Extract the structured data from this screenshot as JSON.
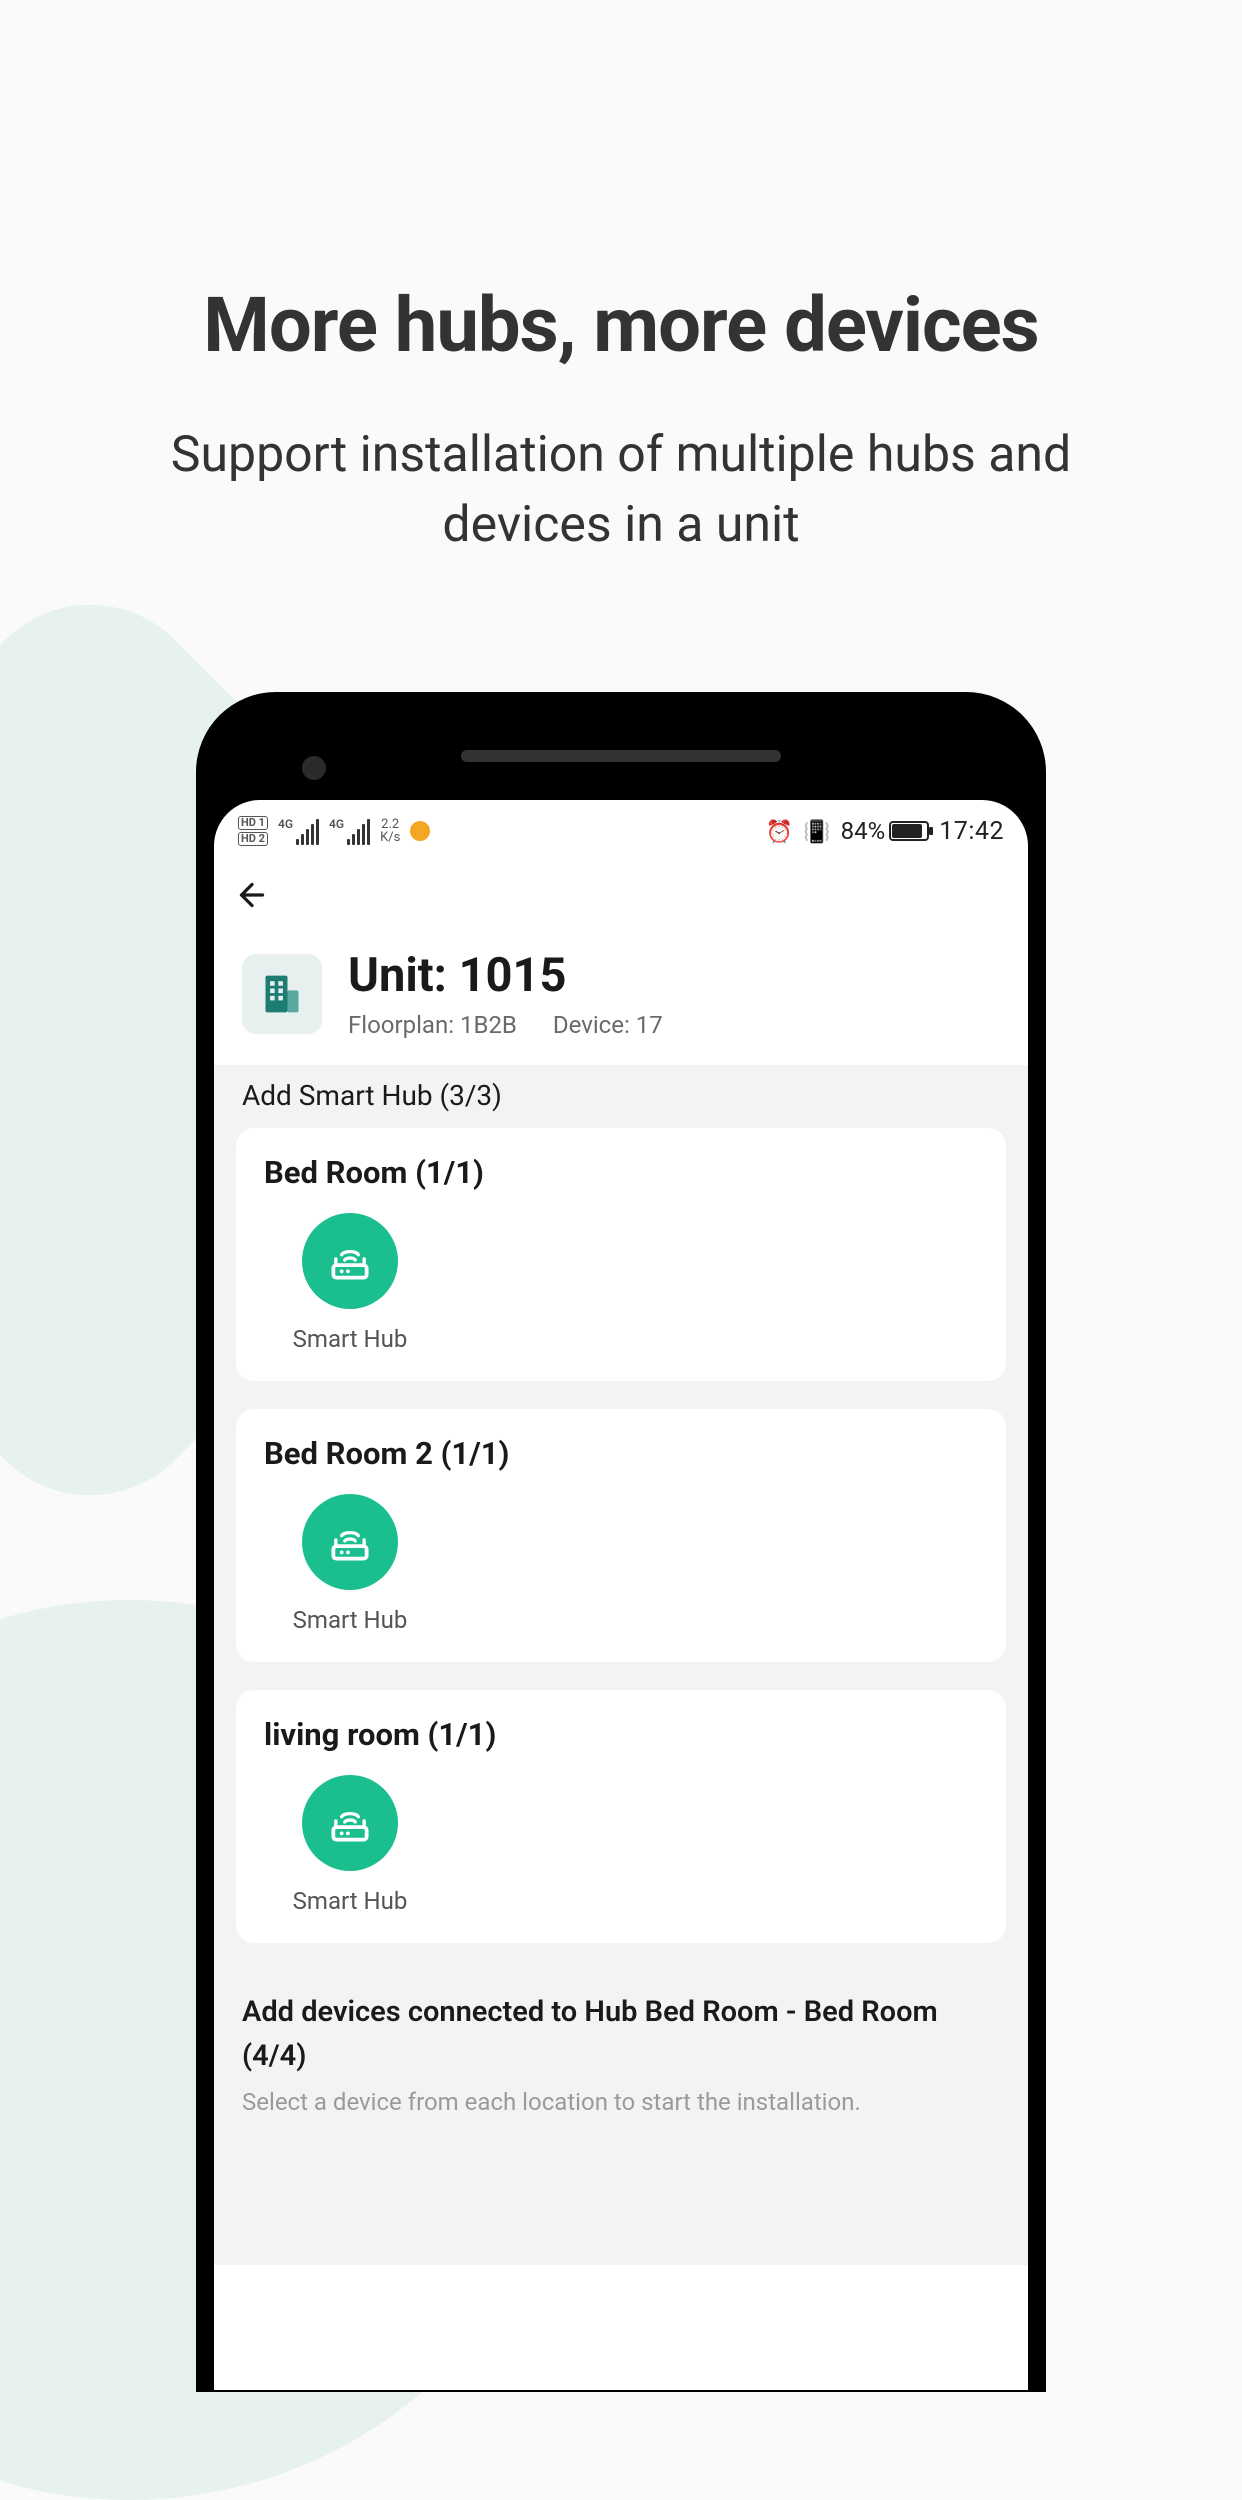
{
  "marketing": {
    "title": "More hubs, more devices",
    "subtitle": "Support installation of multiple hubs and devices in a unit"
  },
  "status": {
    "hd1": "HD 1",
    "hd2": "HD 2",
    "net1_label": "4G",
    "net2_label": "4G",
    "speed_top": "2.2",
    "speed_bottom": "K/s",
    "battery_pct": "84%",
    "time": "17:42"
  },
  "unit": {
    "title": "Unit: 1015",
    "floorplan_label": "Floorplan: 1B2B",
    "device_label": "Device: 17"
  },
  "hub_section": {
    "label": "Add Smart Hub (3/3)"
  },
  "rooms": [
    {
      "name": "Bed Room (1/1)",
      "hub_label": "Smart Hub"
    },
    {
      "name": "Bed Room 2  (1/1)",
      "hub_label": "Smart Hub"
    },
    {
      "name": "living room (1/1)",
      "hub_label": "Smart Hub"
    }
  ],
  "devices_section": {
    "title": "Add devices connected to Hub Bed Room - Bed Room (4/4)",
    "help": "Select a device from each location to start the installation."
  },
  "colors": {
    "accent": "#1bbf8f"
  }
}
